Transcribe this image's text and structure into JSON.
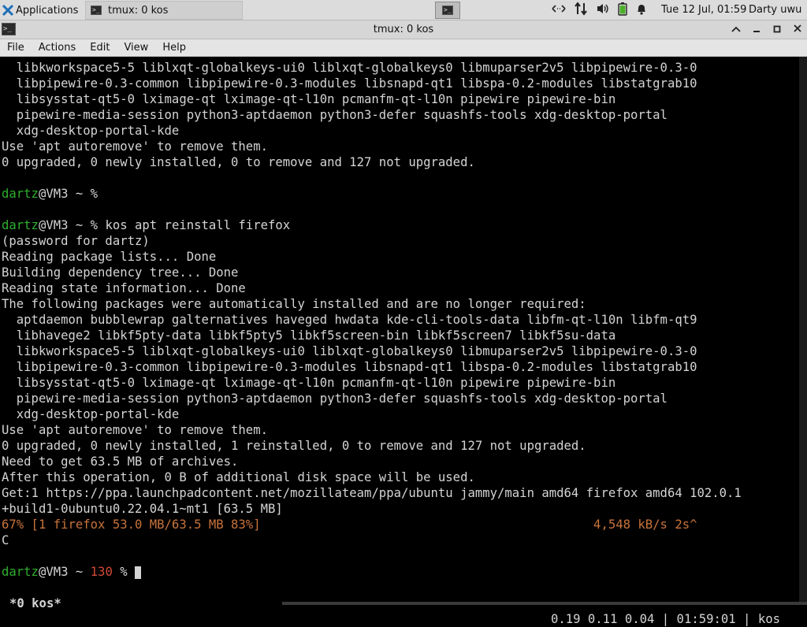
{
  "panel": {
    "apps_label": "Applications",
    "task_label": "tmux: 0 kos",
    "clock": "Tue 12 Jul, 01:59",
    "user": "Darty uwu"
  },
  "window": {
    "title": "tmux: 0 kos"
  },
  "menu": [
    "File",
    "Actions",
    "Edit",
    "View",
    "Help"
  ],
  "terminal": {
    "lines": [
      [
        {
          "t": "  libkworkspace5-5 liblxqt-globalkeys-ui0 liblxqt-globalkeys0 libmuparser2v5 libpipewire-0.3-0"
        }
      ],
      [
        {
          "t": "  libpipewire-0.3-common libpipewire-0.3-modules libsnapd-qt1 libspa-0.2-modules libstatgrab10"
        }
      ],
      [
        {
          "t": "  libsysstat-qt5-0 lximage-qt lximage-qt-l10n pcmanfm-qt-l10n pipewire pipewire-bin"
        }
      ],
      [
        {
          "t": "  pipewire-media-session python3-aptdaemon python3-defer squashfs-tools xdg-desktop-portal"
        }
      ],
      [
        {
          "t": "  xdg-desktop-portal-kde"
        }
      ],
      [
        {
          "t": "Use 'apt autoremove' to remove them."
        }
      ],
      [
        {
          "t": "0 upgraded, 0 newly installed, 0 to remove and 127 not upgraded."
        }
      ],
      [
        {
          "t": ""
        }
      ],
      [
        {
          "t": "dartz",
          "c": "user"
        },
        {
          "t": "@VM3 ~ %"
        }
      ],
      [
        {
          "t": ""
        }
      ],
      [
        {
          "t": "dartz",
          "c": "user"
        },
        {
          "t": "@VM3 ~ % kos apt reinstall firefox"
        }
      ],
      [
        {
          "t": "(password for dartz)"
        }
      ],
      [
        {
          "t": "Reading package lists... Done"
        }
      ],
      [
        {
          "t": "Building dependency tree... Done"
        }
      ],
      [
        {
          "t": "Reading state information... Done"
        }
      ],
      [
        {
          "t": "The following packages were automatically installed and are no longer required:"
        }
      ],
      [
        {
          "t": "  aptdaemon bubblewrap galternatives haveged hwdata kde-cli-tools-data libfm-qt-l10n libfm-qt9"
        }
      ],
      [
        {
          "t": "  libhavege2 libkf5pty-data libkf5pty5 libkf5screen-bin libkf5screen7 libkf5su-data"
        }
      ],
      [
        {
          "t": "  libkworkspace5-5 liblxqt-globalkeys-ui0 liblxqt-globalkeys0 libmuparser2v5 libpipewire-0.3-0"
        }
      ],
      [
        {
          "t": "  libpipewire-0.3-common libpipewire-0.3-modules libsnapd-qt1 libspa-0.2-modules libstatgrab10"
        }
      ],
      [
        {
          "t": "  libsysstat-qt5-0 lximage-qt lximage-qt-l10n pcmanfm-qt-l10n pipewire pipewire-bin"
        }
      ],
      [
        {
          "t": "  pipewire-media-session python3-aptdaemon python3-defer squashfs-tools xdg-desktop-portal"
        }
      ],
      [
        {
          "t": "  xdg-desktop-portal-kde"
        }
      ],
      [
        {
          "t": "Use 'apt autoremove' to remove them."
        }
      ],
      [
        {
          "t": "0 upgraded, 0 newly installed, 1 reinstalled, 0 to remove and 127 not upgraded."
        }
      ],
      [
        {
          "t": "Need to get 63.5 MB of archives."
        }
      ],
      [
        {
          "t": "After this operation, 0 B of additional disk space will be used."
        }
      ],
      [
        {
          "t": "Get:1 https://ppa.launchpadcontent.net/mozillateam/ppa/ubuntu jammy/main amd64 firefox amd64 102.0.1"
        }
      ],
      [
        {
          "t": "+build1-0ubuntu0.22.04.1~mt1 [63.5 MB]"
        }
      ],
      [
        {
          "t": "67% [1 firefox 53.0 MB/63.5 MB 83%]                                             4,548 kB/s 2s^",
          "c": "prog"
        }
      ],
      [
        {
          "t": "C"
        }
      ],
      [
        {
          "t": ""
        }
      ],
      [
        {
          "t": "dartz",
          "c": "user"
        },
        {
          "t": "@VM3 ~ "
        },
        {
          "t": "130",
          "c": "err"
        },
        {
          "t": " % "
        },
        {
          "t": "",
          "c": "cursor"
        }
      ]
    ],
    "status_left": "*0 kos*",
    "status_right": "0.19 0.11 0.04 | 01:59:01 | kos"
  },
  "colors": {
    "prompt_user": "#2faf2f",
    "error_code": "#d24a3a",
    "progress": "#c8733b"
  }
}
